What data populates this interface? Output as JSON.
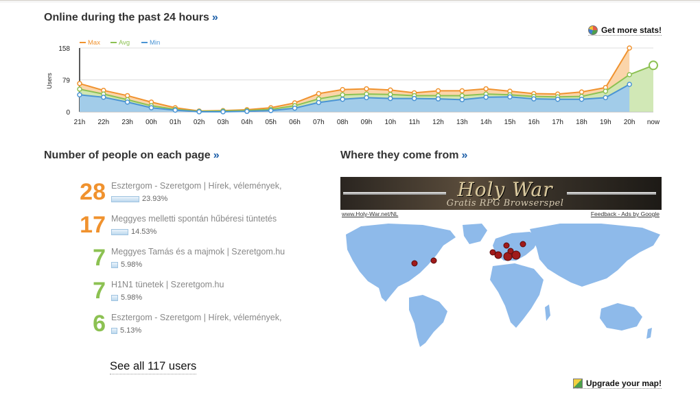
{
  "sections": {
    "online_title": "Online during the past 24 hours",
    "pages_title": "Number of people on each page",
    "where_title": "Where they come from",
    "raquo": "»"
  },
  "links": {
    "get_more_stats": "Get more stats!",
    "see_all": "See all 117 users",
    "upgrade_map": "Upgrade your map!"
  },
  "chart_data": {
    "type": "area",
    "ylabel": "Users",
    "ylim": [
      0,
      158
    ],
    "yticks": [
      0,
      79,
      158
    ],
    "legend_position": "top-left",
    "categories": [
      "21h",
      "22h",
      "23h",
      "00h",
      "01h",
      "02h",
      "03h",
      "04h",
      "05h",
      "06h",
      "07h",
      "08h",
      "09h",
      "10h",
      "11h",
      "12h",
      "13h",
      "14h",
      "15h",
      "16h",
      "17h",
      "18h",
      "19h",
      "20h",
      "now"
    ],
    "series": [
      {
        "name": "Max",
        "color": "#f0922e",
        "fill": "#fbd3a5",
        "values": [
          70,
          53,
          40,
          24,
          10,
          2,
          3,
          5,
          10,
          22,
          45,
          55,
          57,
          54,
          47,
          52,
          52,
          57,
          51,
          45,
          44,
          49,
          60,
          158,
          null
        ]
      },
      {
        "name": "Avg",
        "color": "#8cc152",
        "fill": "#cfe7b2",
        "values": [
          56,
          44,
          30,
          15,
          6,
          1,
          2,
          3,
          6,
          15,
          32,
          42,
          44,
          43,
          40,
          40,
          40,
          44,
          42,
          38,
          37,
          38,
          51,
          92,
          115
        ]
      },
      {
        "name": "Min",
        "color": "#4a94d4",
        "fill": "#9fcaec",
        "values": [
          42,
          36,
          24,
          10,
          4,
          0,
          0,
          1,
          3,
          9,
          23,
          31,
          35,
          33,
          33,
          32,
          30,
          36,
          37,
          32,
          31,
          31,
          35,
          68,
          null
        ]
      }
    ]
  },
  "pages": [
    {
      "count": "28",
      "title": "Esztergom - Szeretgom | Hírek, vélemények,",
      "pct": "23.93%",
      "fraction": 0.2393,
      "color": "#f0922e"
    },
    {
      "count": "17",
      "title": "Meggyes melletti spontán hűbéresi tüntetés",
      "pct": "14.53%",
      "fraction": 0.1453,
      "color": "#f0922e"
    },
    {
      "count": "7",
      "title": "Meggyes Tamás és a majmok | Szeretgom.hu",
      "pct": "5.98%",
      "fraction": 0.0598,
      "color": "#8cc152"
    },
    {
      "count": "7",
      "title": "H1N1 tünetek | Szeretgom.hu",
      "pct": "5.98%",
      "fraction": 0.0598,
      "color": "#8cc152"
    },
    {
      "count": "6",
      "title": "Esztergom - Szeretgom | Hírek, vélemények,",
      "pct": "5.13%",
      "fraction": 0.0513,
      "color": "#8cc152"
    }
  ],
  "ad": {
    "title": "Holy War",
    "subtitle": "Gratis RPG Browserspel",
    "url": "www.Holy-War.net/NL",
    "feedback": "Feedback - Ads by Google"
  },
  "map": {
    "land_color": "#8ebaea",
    "marker_color": "#a01a1a"
  },
  "icons": {
    "stats": "pie-chart-icon",
    "map": "map-icon"
  }
}
